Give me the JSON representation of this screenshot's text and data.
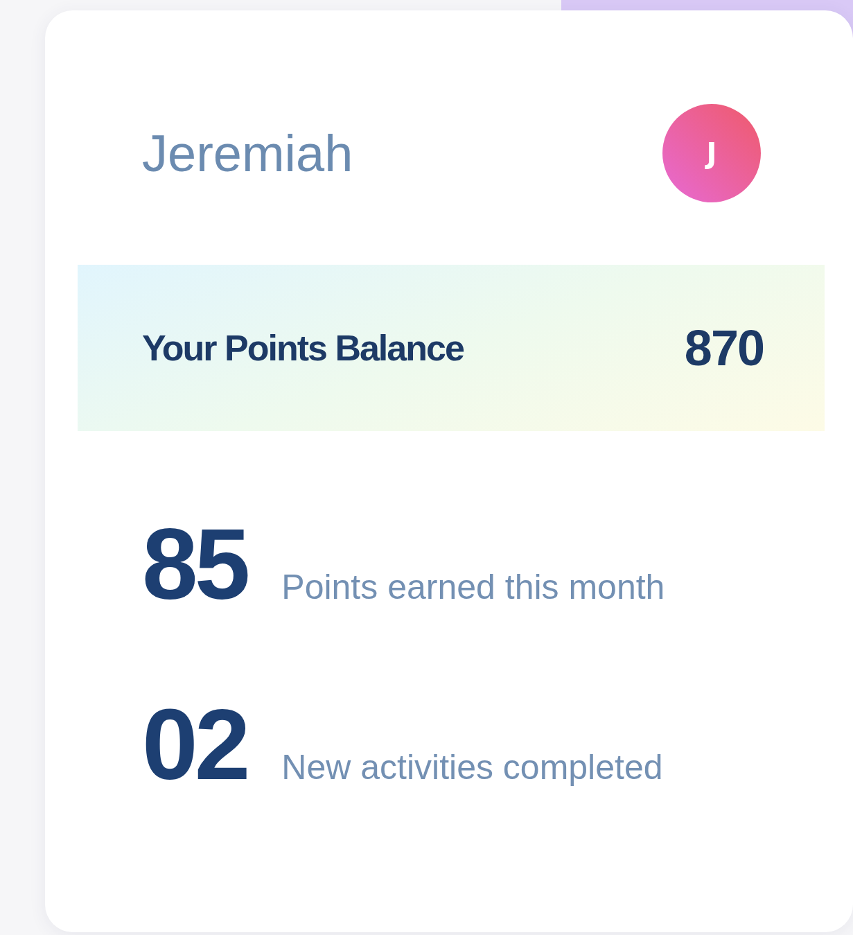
{
  "user": {
    "name": "Jeremiah",
    "avatar_initial": "J"
  },
  "balance": {
    "label": "Your Points Balance",
    "value": "870"
  },
  "stats": [
    {
      "value": "85",
      "label": "Points earned this month"
    },
    {
      "value": "02",
      "label": "New activities completed"
    }
  ]
}
